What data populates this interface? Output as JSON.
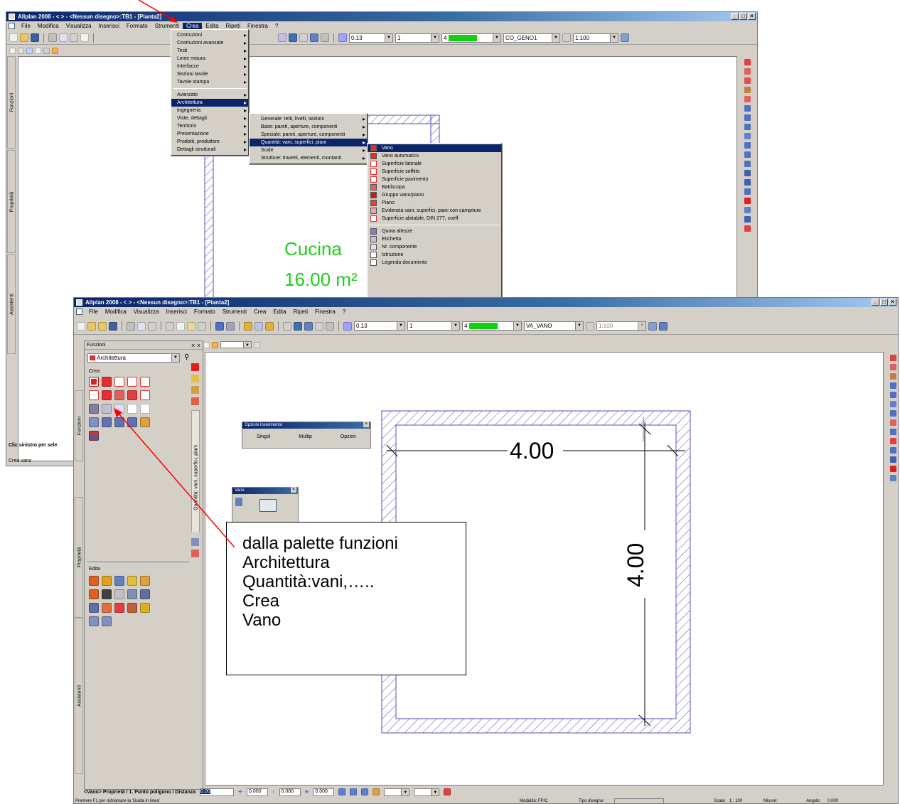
{
  "top_window": {
    "title": "Allplan 2008 - <  > - <Nessun disegno>:TB1 - [Pianta2]",
    "menu": [
      "File",
      "Modifica",
      "Visualizza",
      "Inserisci",
      "Formato",
      "Strumenti",
      "Crea",
      "Edita",
      "Ripeti",
      "Finestra",
      "?"
    ],
    "combo_line": "0.13",
    "combo_pen": "1",
    "combo_color_num": "4",
    "combo_layer": "CO_GENO1",
    "scale_field": "1:100",
    "tabs": [
      "Funzioni",
      "Proprietà",
      "Assistenti"
    ],
    "status_left": "Clic sinistro per sele",
    "status_bottom": "Crea vano",
    "canvas_room_label": "Cucina",
    "canvas_room_area": "16.00 m²"
  },
  "crea_menu": {
    "items": [
      "Costruzioni",
      "Costruzioni avanzate",
      "Testi",
      "Linee misura",
      "Interfacce",
      "Sezioni tavole",
      "Tavole stampa",
      "Avanzato",
      "Architettura",
      "Ingegneria",
      "Viste, dettagli",
      "Territorio",
      "Presentazione",
      "Prodotti, produttore",
      "Dettagli strutturali"
    ]
  },
  "architettura_menu": {
    "items": [
      "Generale: tetti, livelli, sezioni",
      "Base: pareti, aperture, componenti",
      "Speciale: pareti, aperture, componenti",
      "Quantità: vani, superfici, piani",
      "Scale",
      "Strutture: travetti, elementi, montanti"
    ]
  },
  "quantita_menu": {
    "items": [
      "Vano",
      "Vano automatico",
      "Superficie laterale",
      "Superficie soffitto",
      "Superficie pavimento",
      "Battiscopa",
      "Gruppo vano/piano",
      "Piano",
      "Evidenzia vani, superfici, piani con campiture",
      "Superficie abitabile, DIN 277, coeff.",
      "Quota altezze",
      "Etichetta",
      "Nr. componente",
      "Istruzione",
      "Legenda documento"
    ]
  },
  "bottom_window": {
    "title": "Allplan 2008 - <  > - <Nessun disegno>:TB1 - [Pianta2]",
    "menu": [
      "File",
      "Modifica",
      "Visualizza",
      "Inserisci",
      "Formato",
      "Strumenti",
      "Crea",
      "Edita",
      "Ripeti",
      "Finestra",
      "?"
    ],
    "combo_line": "0.13",
    "combo_pen": "1",
    "combo_color_num": "4",
    "combo_layer": "VA_VANO",
    "scale_field": "1:100",
    "palette_title": "Funzioni",
    "palette_close": "× ×",
    "palette_dropdown": "Architettura",
    "palette_section_crea": "Crea",
    "palette_section_edita": "Edita",
    "palette_side_tab": "Quantità: vani, superfici, piani",
    "tabs": [
      "Funzioni",
      "Proprietà",
      "Assistenti"
    ],
    "opzioni_title": "Opzioni inserimento",
    "opzioni_buttons": [
      "Singol",
      "Multip",
      "Opzion"
    ],
    "vano_title": "Vano",
    "dim_horizontal": "4.00",
    "dim_vertical": "4.00",
    "command_line": "<Vano> Proprietà / 1. Punto poligono / Distanza",
    "cmd_field1": "0.000",
    "cmd_field2": "0.000",
    "cmd_field3": "0.000",
    "status_help": "Premere F1 per richiamare la 'Guida in linea'",
    "status_modalita": "Modalità: FP/C",
    "status_tipo": "Tipo disegno:",
    "status_scala": "Scala:",
    "status_scala_val": "1 : 100",
    "status_misure": "Misure:",
    "status_angolo": "Angolo:",
    "status_angolo_val": "0.000"
  },
  "callout": {
    "lines": [
      "dalla palette funzioni",
      "Architettura",
      "Quantità:vani,…..",
      "Crea",
      "Vano"
    ]
  },
  "colors": {
    "title_blue": "#0a246a",
    "highlight_blue": "#0a246a",
    "hatch_blue": "#5050c0",
    "room_label_green": "#22cc22",
    "annotation_red": "#ff0000",
    "chrome_gray": "#d4d0c8"
  }
}
